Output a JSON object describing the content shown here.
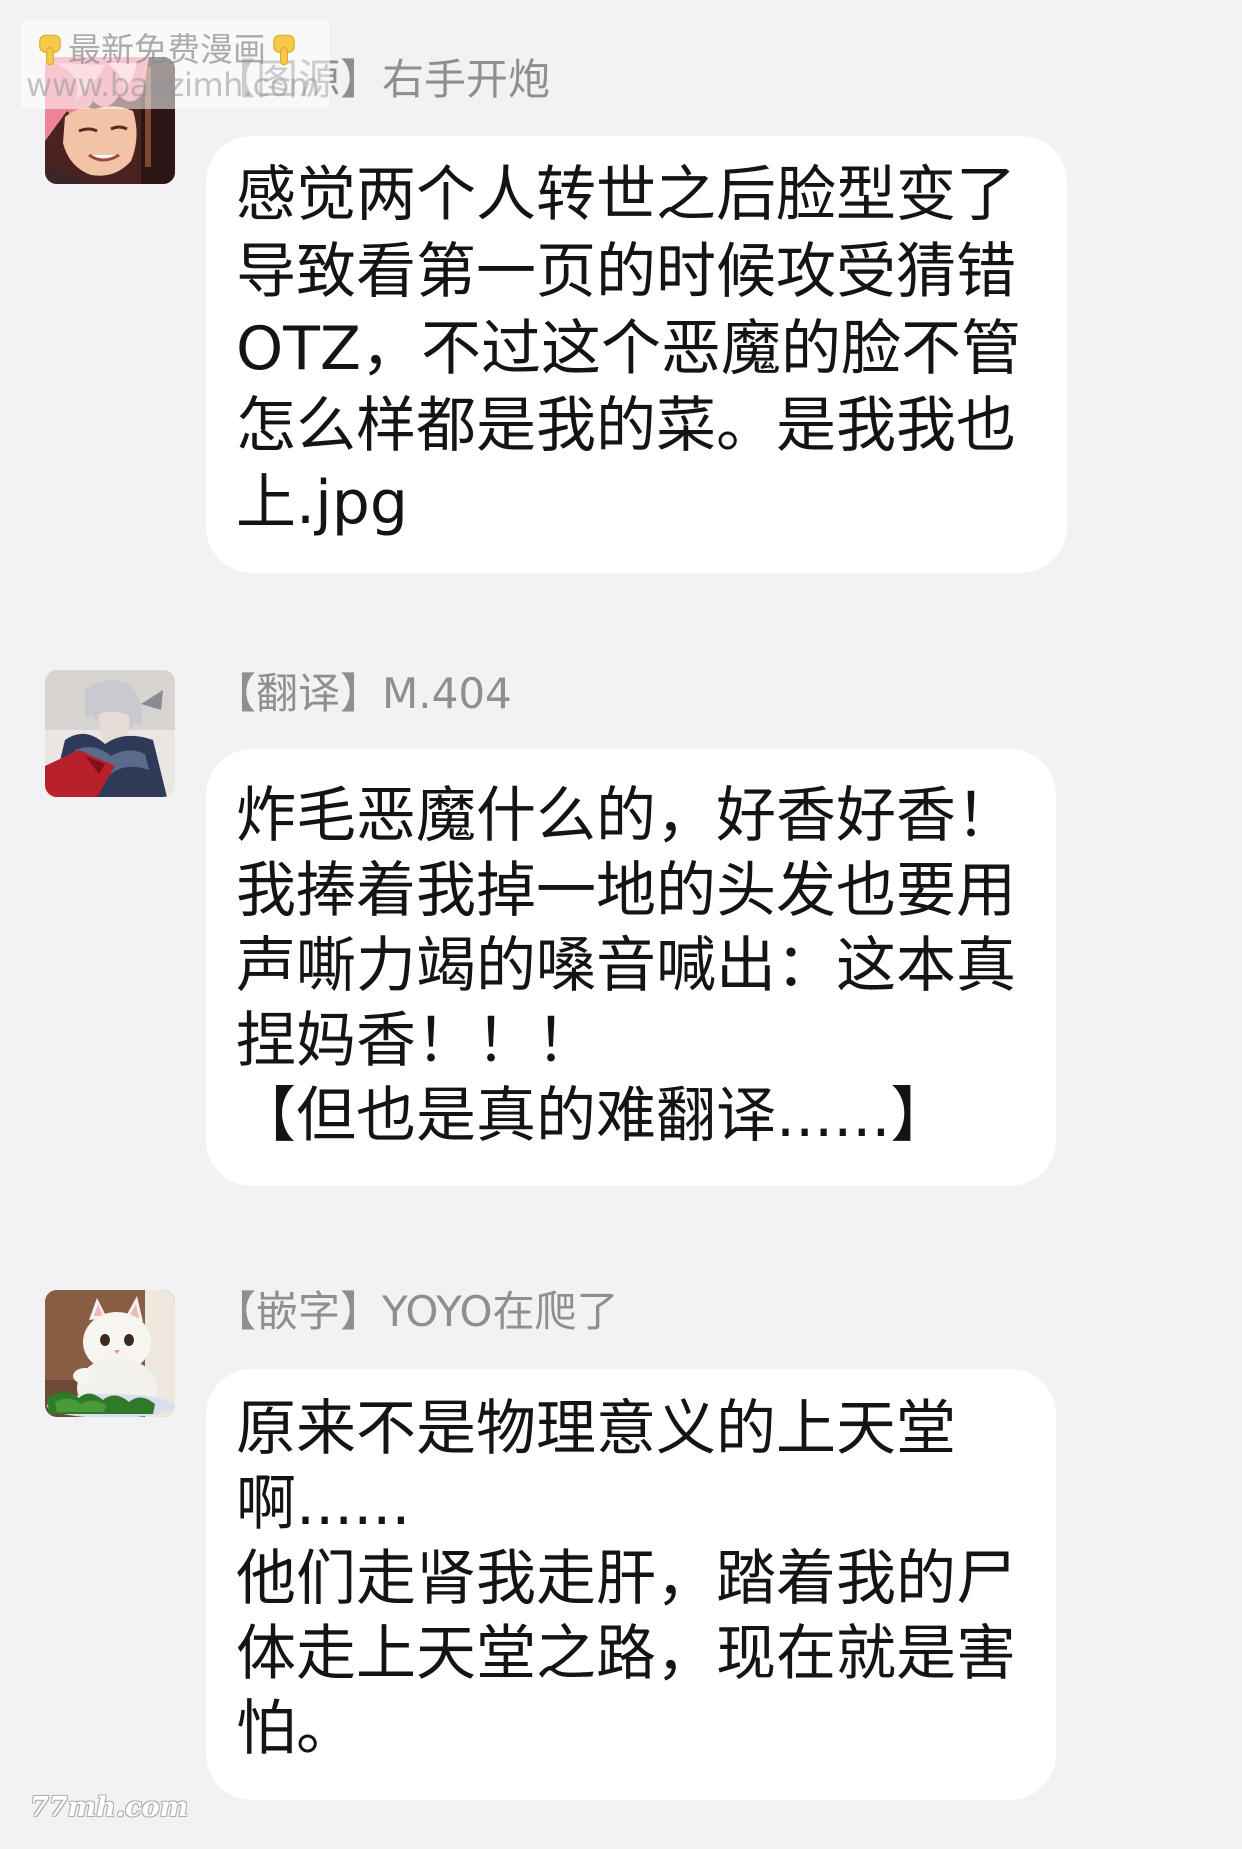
{
  "colors": {
    "background": "#f2f2f4",
    "bubble": "#ffffff",
    "text": "#141414",
    "sender": "#8e8e93"
  },
  "watermark_top": {
    "icon": "pointing-down-hand-icon",
    "text": "最新免费漫画",
    "site": "www.baozimh.com"
  },
  "messages": [
    {
      "avatar": "pink-haired-character-avatar",
      "role": "【图源】",
      "name": "右手开炮",
      "lines": [
        "感觉两个人转世之后脸型变了",
        "导致看第一页的时候攻受猜错",
        "OTZ，不过这个恶魔的脸不管",
        "怎么样都是我的菜。是我我也",
        "上.jpg"
      ]
    },
    {
      "avatar": "silver-haired-knight-avatar",
      "role": "【翻译】",
      "name": "M.404",
      "lines": [
        "炸毛恶魔什么的，好香好香！",
        "我捧着我掉一地的头发也要用",
        "声嘶力竭的嗓音喊出：这本真",
        "捏妈香！！！",
        "【但也是真的难翻译......】"
      ]
    },
    {
      "avatar": "white-cat-avatar",
      "role": "【嵌字】",
      "name": "YOYO在爬了",
      "lines": [
        "原来不是物理意义的上天堂",
        "啊......",
        "他们走肾我走肝，踏着我的尸",
        "体走上天堂之路，现在就是害",
        "怕。"
      ]
    }
  ],
  "watermark_bottom": "77mh.com"
}
